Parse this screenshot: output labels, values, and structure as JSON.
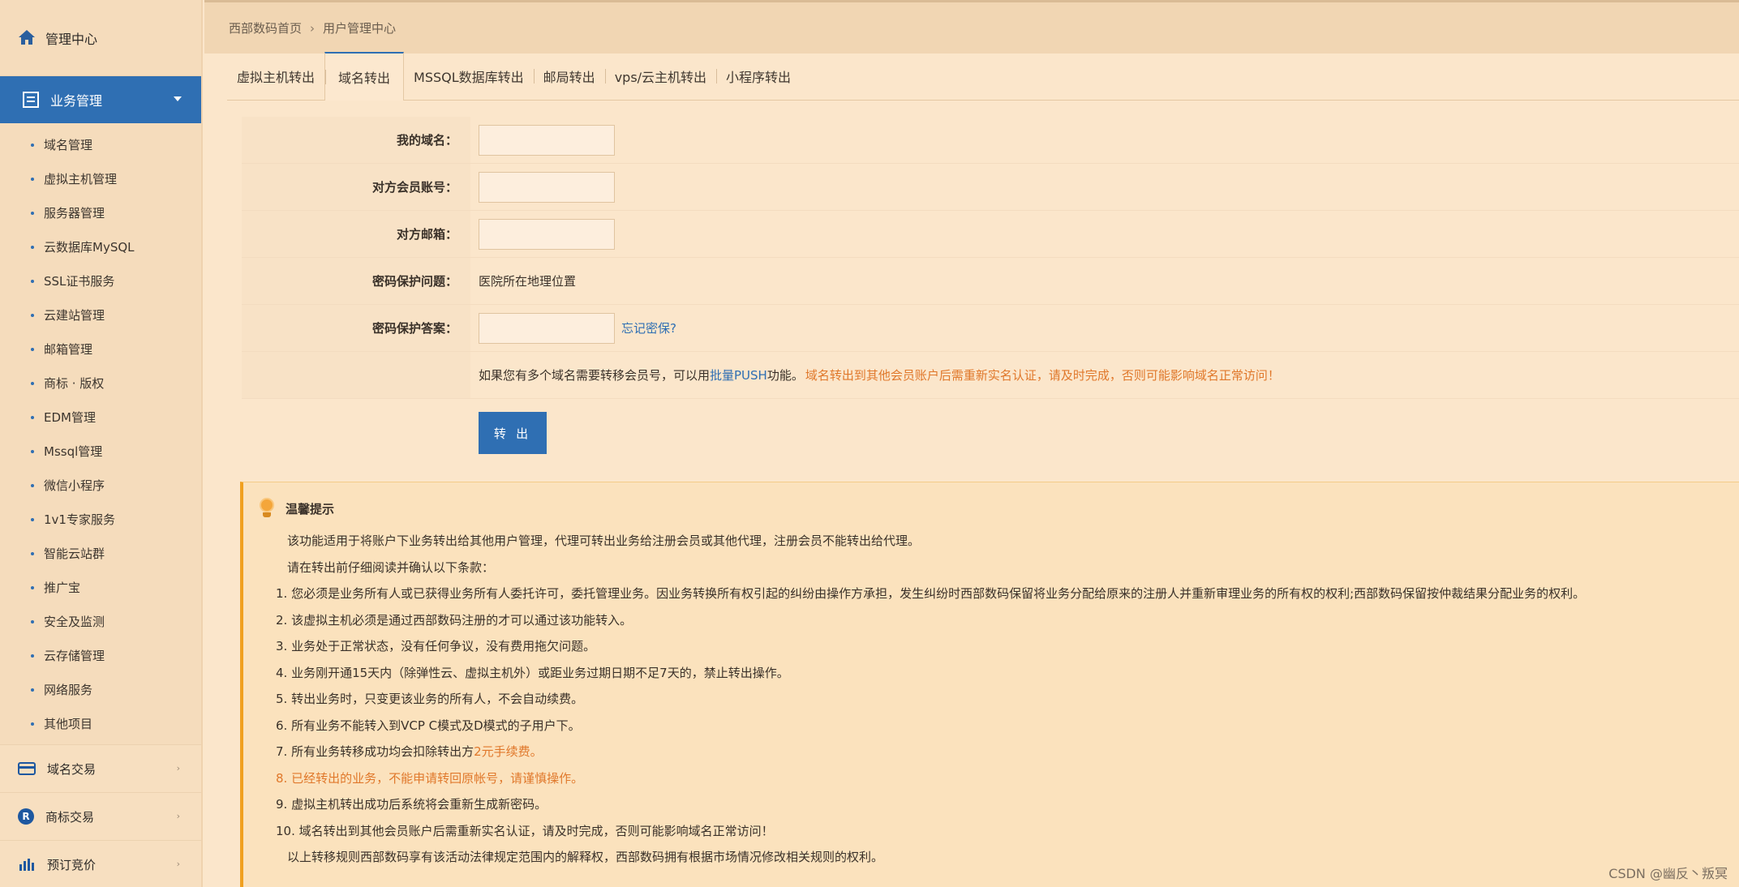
{
  "sidebar": {
    "title": "管理中心",
    "active_group": "业务管理",
    "items": [
      {
        "label": "域名管理"
      },
      {
        "label": "虚拟主机管理"
      },
      {
        "label": "服务器管理"
      },
      {
        "label": "云数据库MySQL"
      },
      {
        "label": "SSL证书服务"
      },
      {
        "label": "云建站管理"
      },
      {
        "label": "邮箱管理"
      },
      {
        "label": "商标 · 版权"
      },
      {
        "label": "EDM管理"
      },
      {
        "label": "Mssql管理"
      },
      {
        "label": "微信小程序"
      },
      {
        "label": "1v1专家服务"
      },
      {
        "label": "智能云站群"
      },
      {
        "label": "推广宝"
      },
      {
        "label": "安全及监测"
      },
      {
        "label": "云存储管理"
      },
      {
        "label": "网络服务"
      },
      {
        "label": "其他项目"
      }
    ],
    "groups": [
      {
        "label": "域名交易",
        "icon": "card-icon"
      },
      {
        "label": "商标交易",
        "icon": "R"
      },
      {
        "label": "预订竞价",
        "icon": "bar-chart-icon"
      }
    ]
  },
  "breadcrumb": {
    "home": "西部数码首页",
    "separator": "›",
    "current": "用户管理中心"
  },
  "tabs": [
    {
      "label": "虚拟主机转出"
    },
    {
      "label": "域名转出",
      "active": true
    },
    {
      "label": "MSSQL数据库转出"
    },
    {
      "label": "邮局转出"
    },
    {
      "label": "vps/云主机转出"
    },
    {
      "label": "小程序转出"
    }
  ],
  "form": {
    "my_domain_label": "我的域名：",
    "my_domain_value": "",
    "target_account_label": "对方会员账号：",
    "target_account_value": "",
    "target_email_label": "对方邮箱：",
    "target_email_value": "",
    "question_label": "密码保护问题：",
    "question_value": "医院所在地理位置",
    "answer_label": "密码保护答案：",
    "answer_value": "",
    "forgot_link": "忘记密保?",
    "notice_prefix": "如果您有多个域名需要转移会员号，可以用",
    "notice_link": "批量PUSH",
    "notice_mid": "功能。",
    "notice_warning": "域名转出到其他会员账户后需重新实名认证，请及时完成，否则可能影响域名正常访问！",
    "submit_label": "转 出"
  },
  "tips": {
    "title": "温馨提示",
    "intro1": "该功能适用于将账户下业务转出给其他用户管理，代理可转出业务给注册会员或其他代理，注册会员不能转出给代理。",
    "intro2": "请在转出前仔细阅读并确认以下条款：",
    "items": [
      "1. 您必须是业务所有人或已获得业务所有人委托许可，委托管理业务。因业务转换所有权引起的纠纷由操作方承担，发生纠纷时西部数码保留将业务分配给原来的注册人并重新审理业务的所有权的权利;西部数码保留按仲裁结果分配业务的权利。",
      "2. 该虚拟主机必须是通过西部数码注册的才可以通过该功能转入。",
      "3. 业务处于正常状态，没有任何争议，没有费用拖欠问题。",
      "4. 业务刚开通15天内（除弹性云、虚拟主机外）或距业务过期日期不足7天的，禁止转出操作。",
      "5. 转出业务时，只变更该业务的所有人，不会自动续费。",
      "6. 所有业务不能转入到VCP C模式及D模式的子用户下。"
    ],
    "item7_prefix": "7. 所有业务转移成功均会扣除转出方",
    "item7_highlight": "2元手续费。",
    "item8": "8. 已经转出的业务，不能申请转回原帐号，请谨慎操作。",
    "item9": "9. 虚拟主机转出成功后系统将会重新生成新密码。",
    "item10": "10. 域名转出到其他会员账户后需重新实名认证，请及时完成，否则可能影响域名正常访问！",
    "footer": "以上转移规则西部数码享有该活动法律规定范围内的解释权，西部数码拥有根据市场情况修改相关规则的权利。"
  },
  "watermark": "CSDN @幽反丶叛冥"
}
